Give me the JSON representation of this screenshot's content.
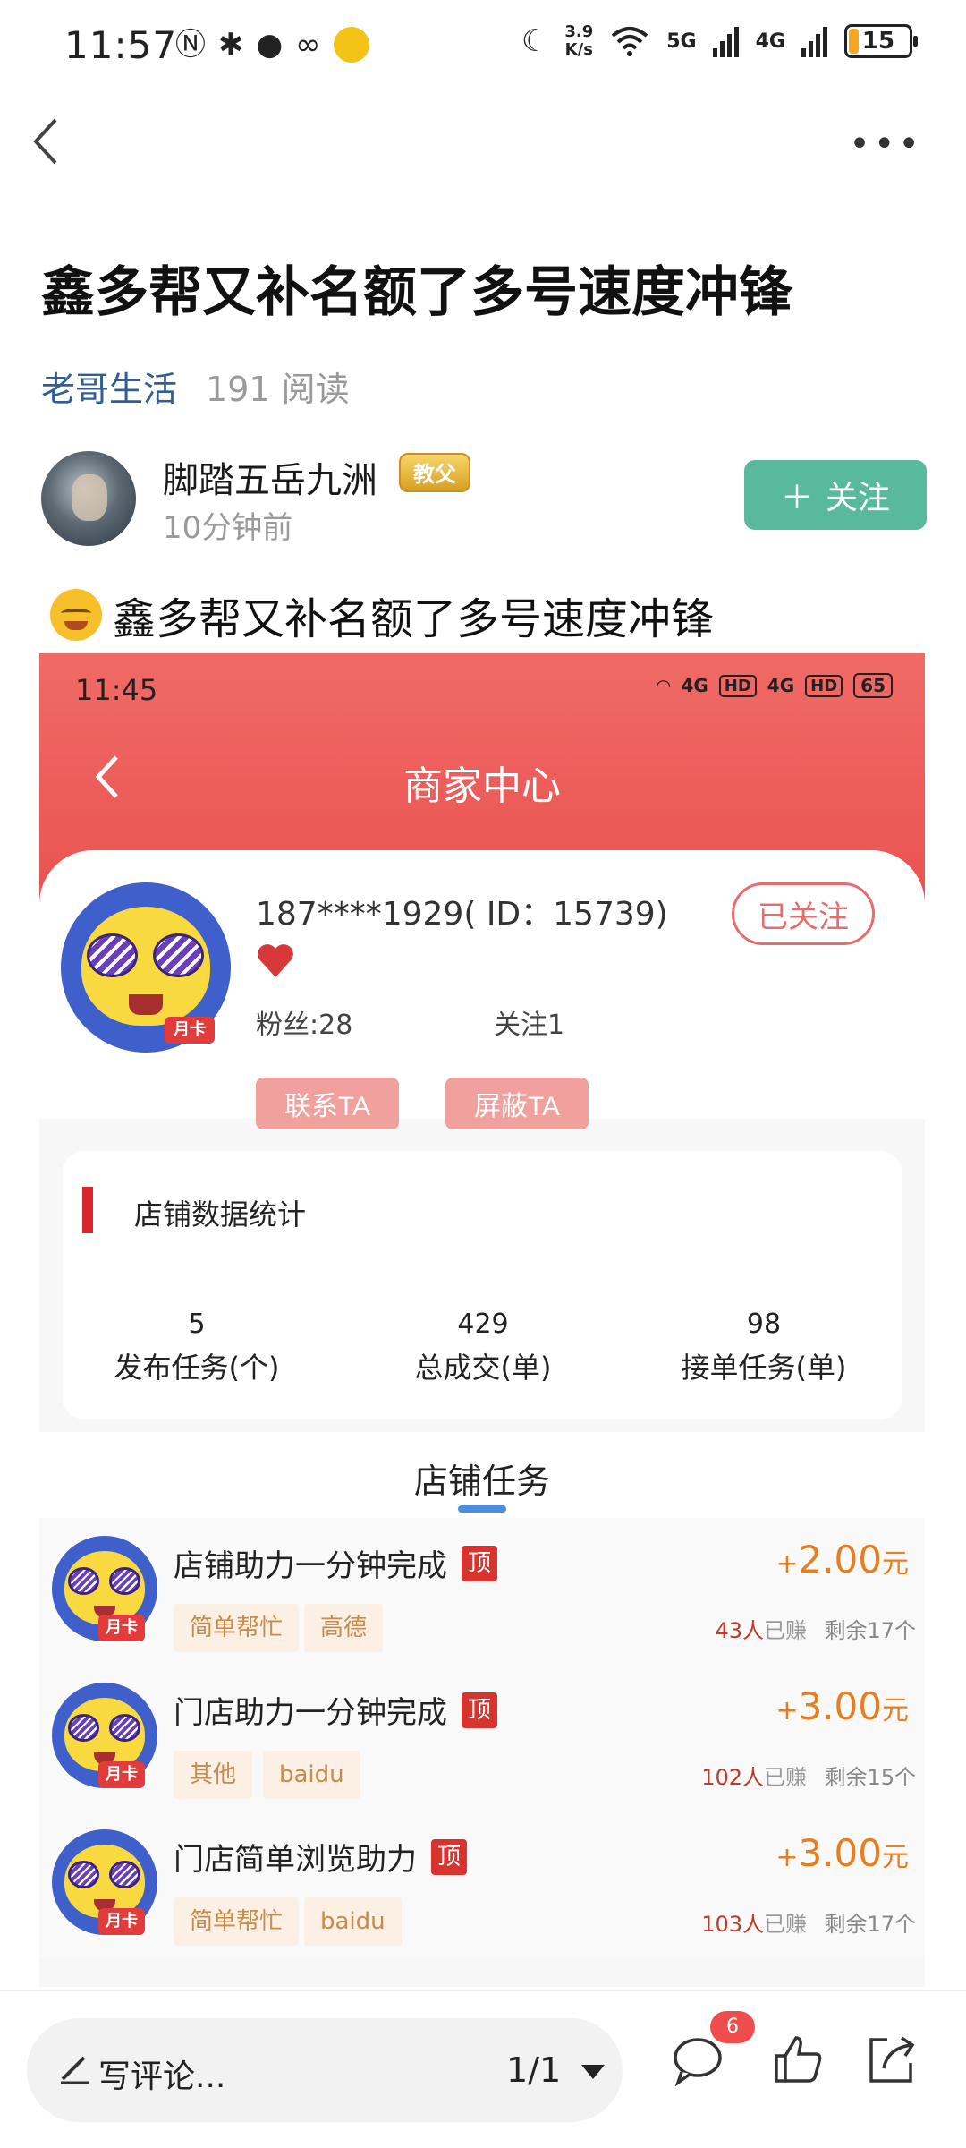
{
  "status_bar": {
    "time": "11:57",
    "net_speed_value": "3.9",
    "net_speed_unit": "K/s",
    "net_5g": "5G",
    "net_4g": "4G",
    "battery_level": "15",
    "battery_fraction": 0.15
  },
  "article": {
    "title": "鑫多帮又补名额了多号速度冲锋",
    "channel": "老哥生活",
    "reads": "191 阅读",
    "author_name": "脚踏五岳九洲",
    "author_badge": "教父",
    "post_time": "10分钟前",
    "follow_label": "关注",
    "subtitle": "鑫多帮又补名额了多号速度冲锋"
  },
  "shot": {
    "time": "11:45",
    "net": "4G",
    "hd": "HD",
    "battery": "65",
    "page_title": "商家中心",
    "user_id": "187****1929( ID：15739)",
    "fans": "粉丝:28",
    "following": "关注1",
    "followed_label": "已关注",
    "contact_label": "联系TA",
    "block_label": "屏蔽TA",
    "avatar_badge": "月卡",
    "stats_title": "店铺数据统计",
    "stats": [
      {
        "value": "5",
        "label": "发布任务(个)"
      },
      {
        "value": "429",
        "label": "总成交(单)"
      },
      {
        "value": "98",
        "label": "接单任务(单)"
      }
    ],
    "tasks_title": "店铺任务",
    "pin_label": "顶",
    "earned_suffix": "已赚",
    "tasks": [
      {
        "name": "店铺助力一分钟完成",
        "tags": [
          "简单帮忙",
          "高德"
        ],
        "price": "2.00",
        "earned": "43人",
        "remaining": "剩余17个"
      },
      {
        "name": "门店助力一分钟完成",
        "tags": [
          "其他",
          "baidu"
        ],
        "price": "3.00",
        "earned": "102人",
        "remaining": "剩余15个"
      },
      {
        "name": "门店简单浏览助力",
        "tags": [
          "简单帮忙",
          "baidu"
        ],
        "price": "3.00",
        "earned": "103人",
        "remaining": "剩余17个"
      }
    ]
  },
  "bottom_bar": {
    "comment_placeholder": "写评论...",
    "page_indicator": "1/1",
    "comment_count": "6"
  },
  "colors": {
    "accent_green": "#58b99b",
    "channel_blue": "#2d5e96",
    "header_red": "#e9514f",
    "price_orange": "#e67e22",
    "badge_red": "#ef4d4d"
  },
  "icons": [
    "back-icon",
    "more-icon",
    "plus-icon",
    "heart-icon",
    "pencil-icon",
    "comment-icon",
    "like-icon",
    "share-icon"
  ]
}
